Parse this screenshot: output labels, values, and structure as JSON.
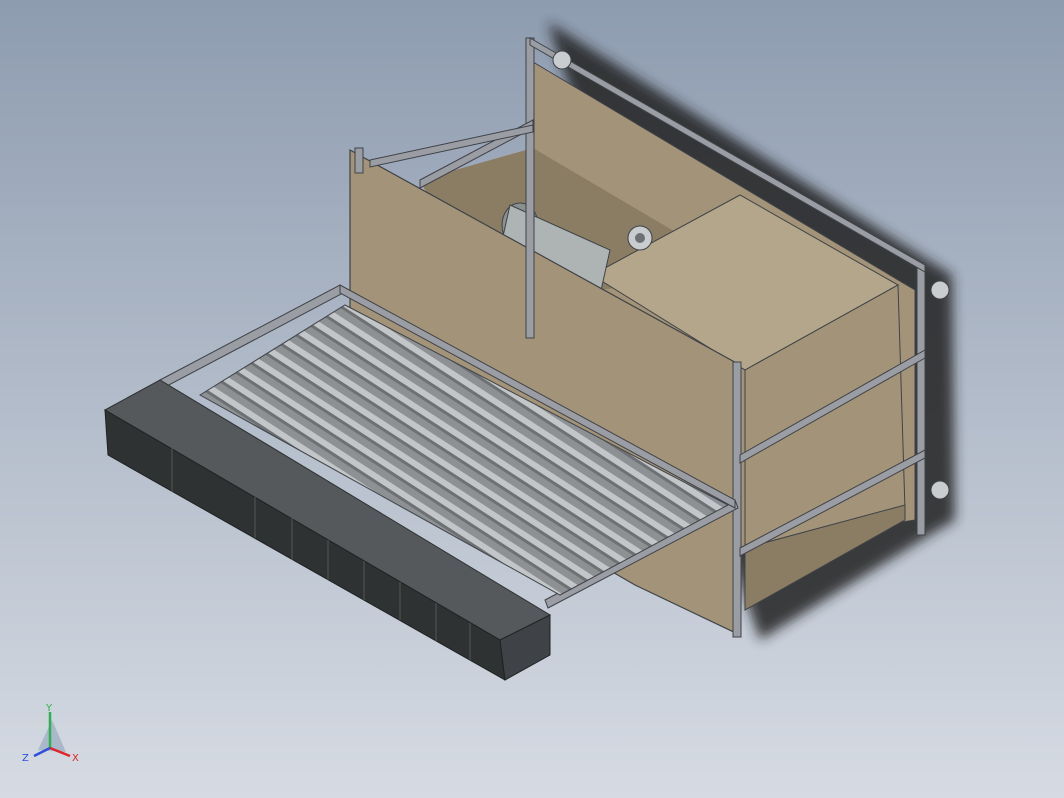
{
  "viewport": {
    "background_top": "#8e9cb0",
    "background_bottom": "#d6dbe3"
  },
  "model": {
    "panel_color": "#a39479",
    "panel_light": "#b4a68b",
    "frame_color": "#9a9da3",
    "frame_dark": "#3f4247",
    "roller_light": "#c3c6c8",
    "roller_dark": "#6d7174",
    "bin_color": "#55595b",
    "bin_dark": "#2f3233",
    "motor_color": "#aeb3b3"
  },
  "triad": {
    "x_label": "X",
    "y_label": "Y",
    "z_label": "Z",
    "x_color": "#e0242a",
    "y_color": "#2bb24a",
    "z_color": "#2f4fd9"
  }
}
